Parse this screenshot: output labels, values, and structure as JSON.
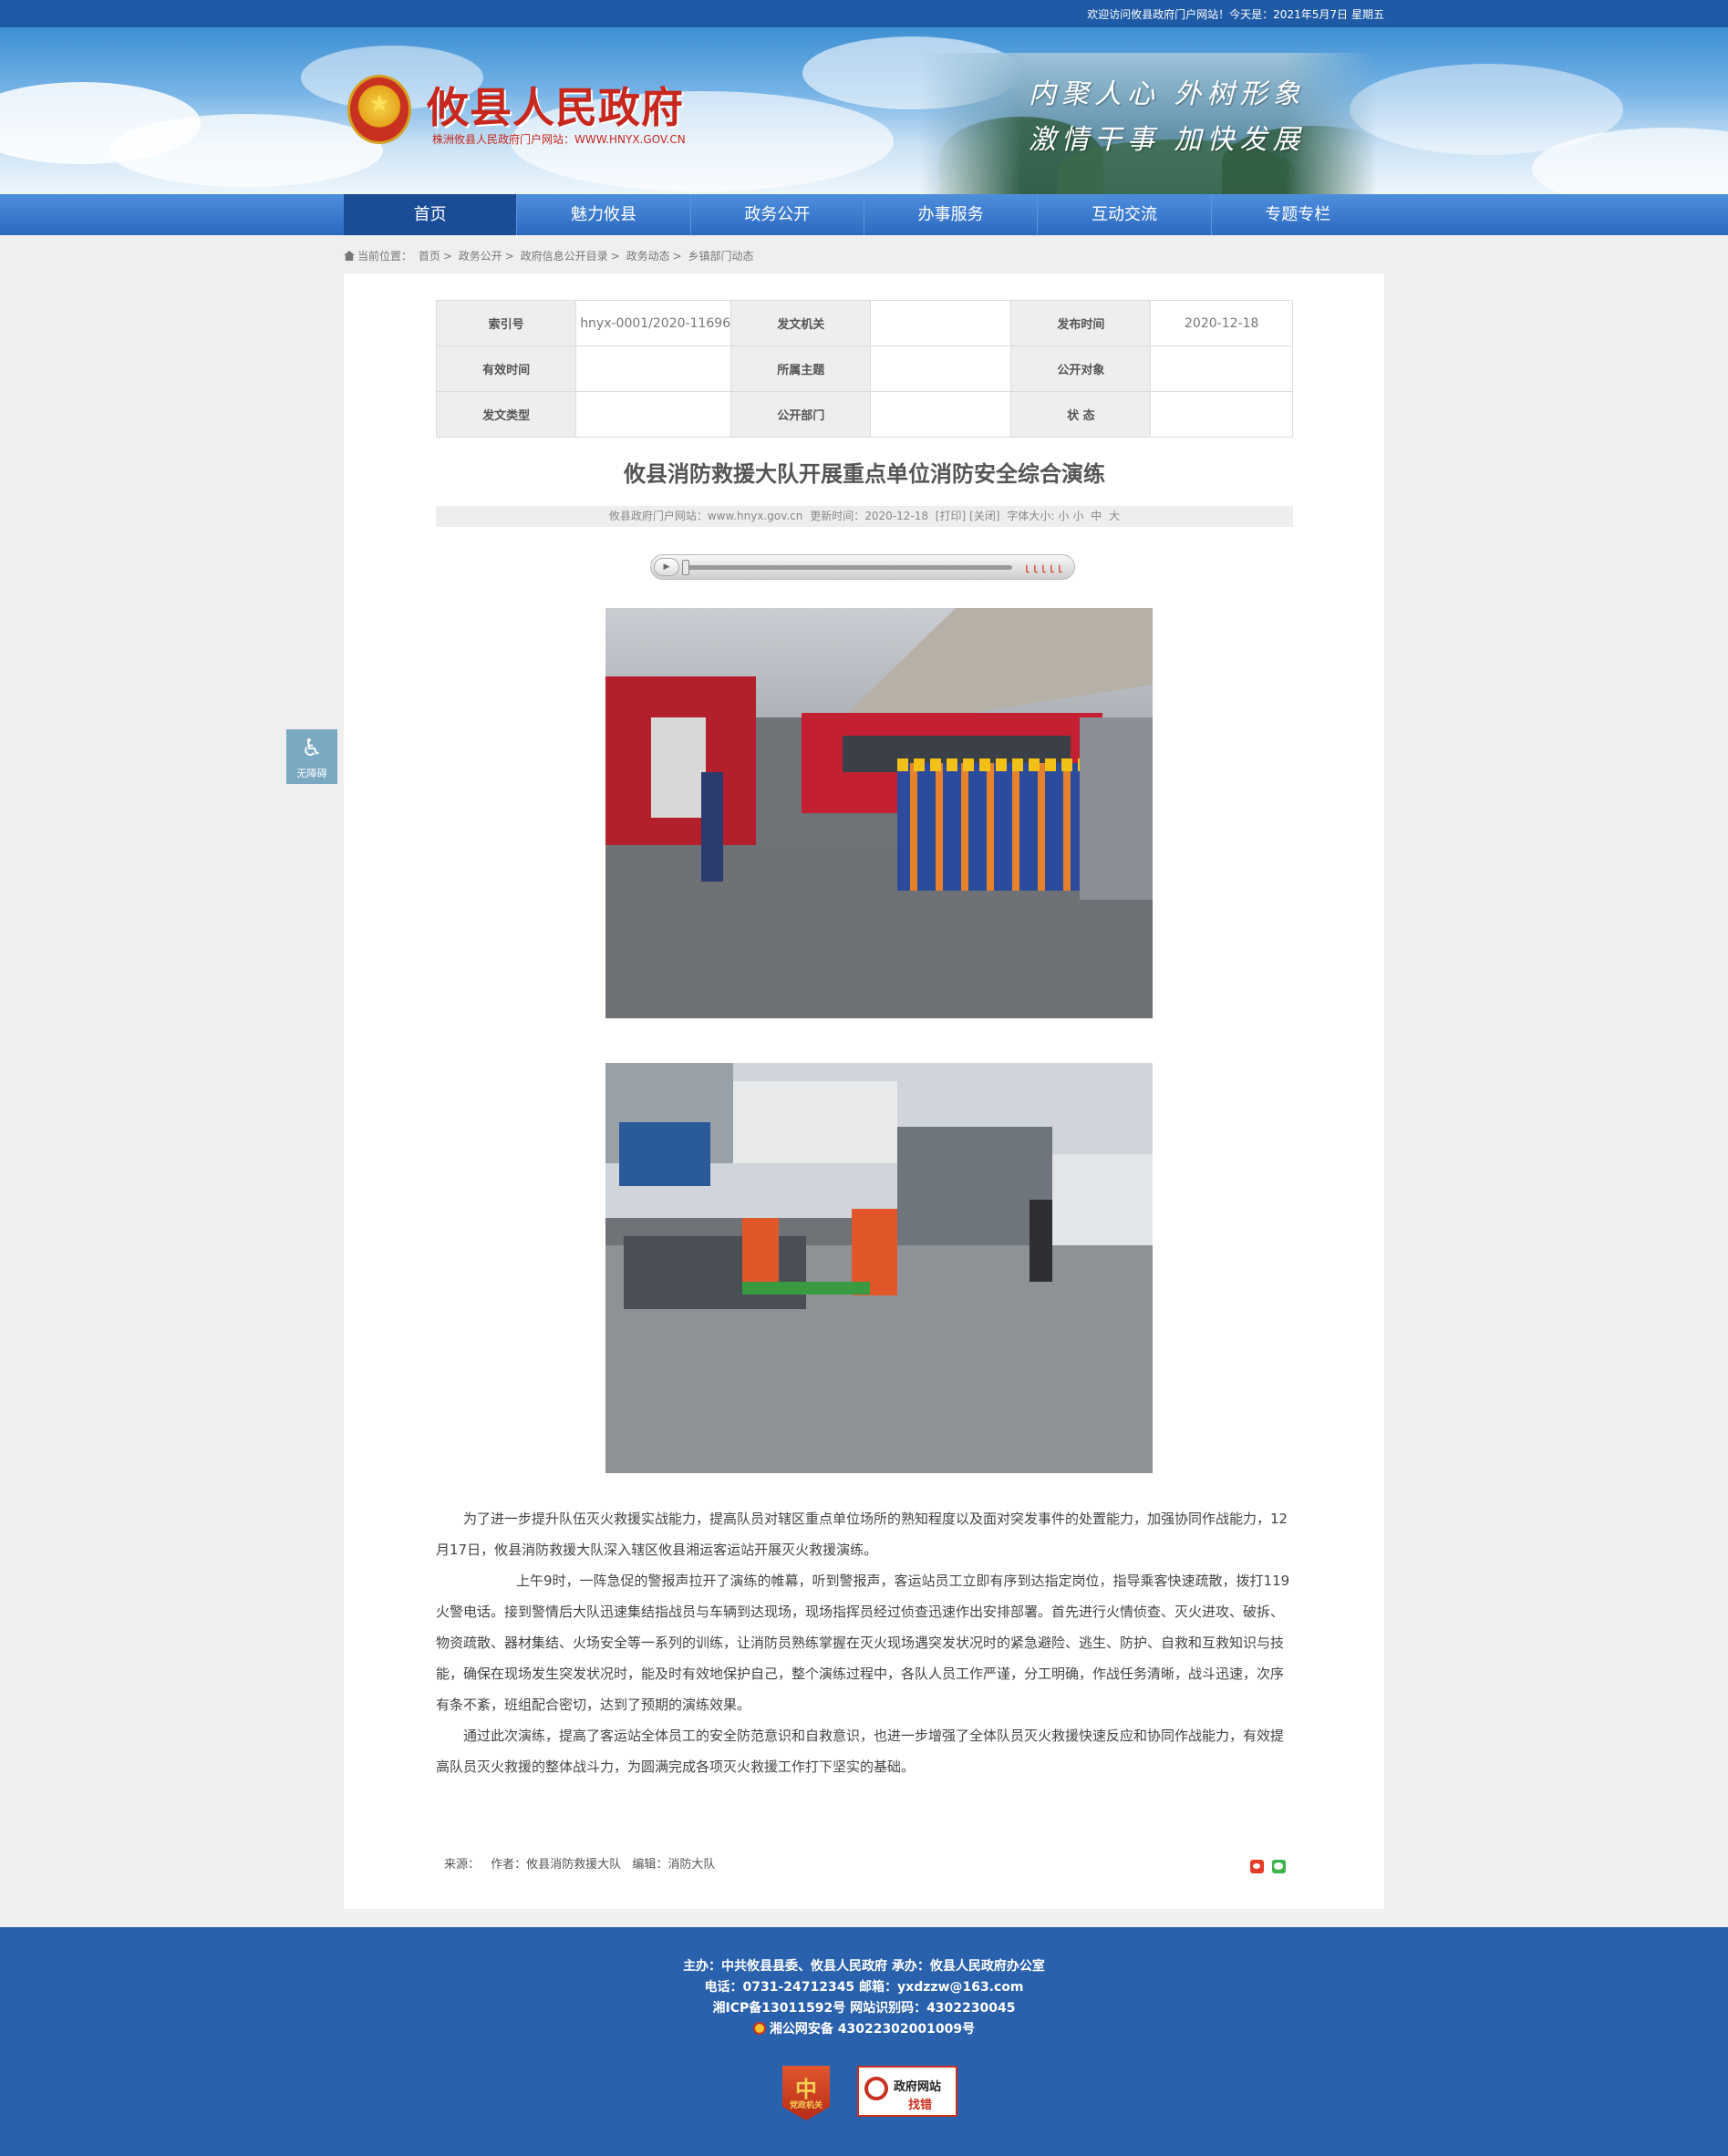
{
  "topbar": {
    "welcome": "欢迎访问攸县政府门户网站！今天是：2021年5月7日",
    "weekday": "星期五"
  },
  "header": {
    "site_title": "攸县人民政府",
    "site_subtitle": "株洲攸县人民政府门户网站：WWW.HNYX.GOV.CN",
    "slogan_line1": "内聚人心  外树形象",
    "slogan_line2": "激情干事  加快发展",
    "emblem_icon": "national-emblem-icon"
  },
  "nav": {
    "items": [
      "首页",
      "魅力攸县",
      "政务公开",
      "办事服务",
      "互动交流",
      "专题专栏"
    ],
    "active_index": 0
  },
  "breadcrumb": {
    "label": "当前位置：",
    "items": [
      "首页",
      "政务公开",
      "政府信息公开目录",
      "政务动态",
      "乡镇部门动态"
    ],
    "separator": ">"
  },
  "meta": {
    "rows": [
      [
        {
          "label": "索引号",
          "value": "hnyx-0001/2020-11696"
        },
        {
          "label": "发文机关",
          "value": ""
        },
        {
          "label": "发布时间",
          "value": "2020-12-18"
        }
      ],
      [
        {
          "label": "有效时间",
          "value": ""
        },
        {
          "label": "所属主题",
          "value": ""
        },
        {
          "label": "公开对象",
          "value": ""
        }
      ],
      [
        {
          "label": "发文类型",
          "value": ""
        },
        {
          "label": "公开部门",
          "value": ""
        },
        {
          "label": "状 态",
          "value": ""
        }
      ]
    ]
  },
  "article": {
    "title": "攸县消防救援大队开展重点单位消防安全综合演练",
    "info": {
      "source_site": "攸县政府门户网站：www.hnyx.gov.cn",
      "update_time": "更新时间：2020-12-18",
      "print": "[打印]",
      "close": "[关闭]",
      "font_size_label": "字体大小:",
      "size_small": "小",
      "size_medium": "中",
      "size_large": "大"
    },
    "audio": {
      "play_icon": "play-icon",
      "volume_icon": "volume-bars-icon"
    },
    "photos": [
      {
        "alt": "firefighters-lined-up-at-bus-station"
      },
      {
        "alt": "firefighters-rescue-drill-in-waiting-hall"
      }
    ],
    "paragraphs": [
      "为了进一步提升队伍灭火救援实战能力，提高队员对辖区重点单位场所的熟知程度以及面对突发事件的处置能力，加强协同作战能力，12月17日，攸县消防救援大队深入辖区攸县湘运客运站开展灭火救援演练。",
      "上午9时，一阵急促的警报声拉开了演练的帷幕，听到警报声，客运站员工立即有序到达指定岗位，指导乘客快速疏散，拨打119火警电话。接到警情后大队迅速集结指战员与车辆到达现场，现场指挥员经过侦查迅速作出安排部署。首先进行火情侦查、灭火进攻、破拆、物资疏散、器材集结、火场安全等一系列的训练，让消防员熟练掌握在灭火现场遇突发状况时的紧急避险、逃生、防护、自救和互救知识与技能，确保在现场发生突发状况时，能及时有效地保护自己，整个演练过程中，各队人员工作严谨，分工明确，作战任务清晰，战斗迅速，次序有条不紊，班组配合密切，达到了预期的演练效果。",
      "通过此次演练，提高了客运站全体员工的安全防范意识和自救意识，也进一步增强了全体队员灭火救援快速反应和协同作战能力，有效提高队员灭火救援的整体战斗力，为圆满完成各项灭火救援工作打下坚实的基础。"
    ],
    "footer": {
      "source": "来源：",
      "author": "作者：攸县消防救援大队",
      "editor": "编辑：消防大队"
    },
    "share": {
      "weibo_icon": "weibo-share-icon",
      "wechat_icon": "wechat-share-icon"
    }
  },
  "accessibility": {
    "label": "无障碍",
    "icon": "wheelchair-icon"
  },
  "footer": {
    "line1": "主办：中共攸县县委、攸县人民政府  承办：攸县人民政府办公室",
    "line2": "电话：0731-24712345  邮箱：yxdzzw@163.com",
    "line3": "湘ICP备13011592号    网站识别码：4302230045",
    "line4": "湘公网安备 43022302001009号",
    "badge_party_mark": "中",
    "badge_party_label": "党政机关",
    "badge_error_line1": "政府网站",
    "badge_error_line2": "找错"
  }
}
